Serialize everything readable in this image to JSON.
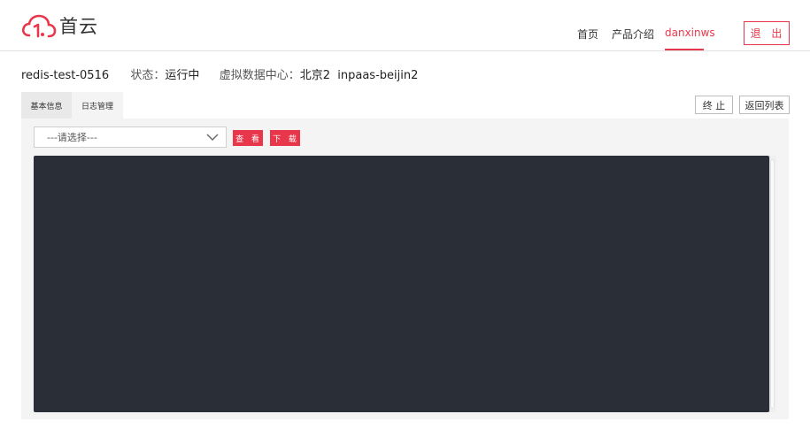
{
  "brand": {
    "name": "首云",
    "accent": "#e8374b"
  },
  "nav": {
    "items": [
      {
        "label": "首页"
      },
      {
        "label": "产品介绍"
      },
      {
        "label": "danxinws"
      }
    ],
    "logout": "退 出"
  },
  "instance": {
    "name": "redis-test-0516",
    "status_label": "状态：",
    "status_value": "运行中",
    "dc_label": "虚拟数据中心：",
    "dc_value": "北京2  inpaas-beijin2"
  },
  "tabs": [
    {
      "label": "基本信息"
    },
    {
      "label": "日志管理"
    }
  ],
  "actions": {
    "stop": "终 止",
    "back": "返回列表"
  },
  "log": {
    "select_value": "---请选择---",
    "view": "查 看",
    "download": "下 载"
  }
}
